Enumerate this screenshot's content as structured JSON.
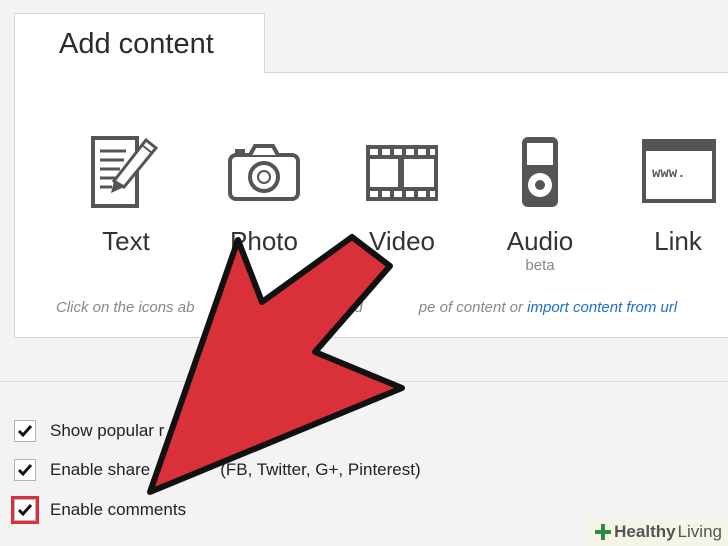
{
  "tab": {
    "title": "Add content"
  },
  "content_types": [
    {
      "label": "Text",
      "icon": "text-document-icon"
    },
    {
      "label": "Photo",
      "icon": "camera-icon"
    },
    {
      "label": "Video",
      "icon": "film-strip-icon"
    },
    {
      "label": "Audio",
      "icon": "audio-player-icon",
      "sublabel": "beta"
    },
    {
      "label": "Link",
      "icon": "browser-window-icon",
      "icon_text": "www."
    }
  ],
  "hint": {
    "text": "Click on the icons ab",
    "text_mid": "d",
    "text_end": "pe of content or",
    "link": "import content from url"
  },
  "options": [
    {
      "label": "Show popular r",
      "tail": ")",
      "checked": true
    },
    {
      "label": "Enable share",
      "tail": "(FB, Twitter, G+, Pinterest)",
      "checked": true
    },
    {
      "label": "Enable comments",
      "checked": true,
      "highlighted": true
    }
  ],
  "annotation": {
    "shape": "arrow",
    "color": "#d9303a"
  },
  "watermark": {
    "bold": "Healthy",
    "regular": "Living"
  }
}
